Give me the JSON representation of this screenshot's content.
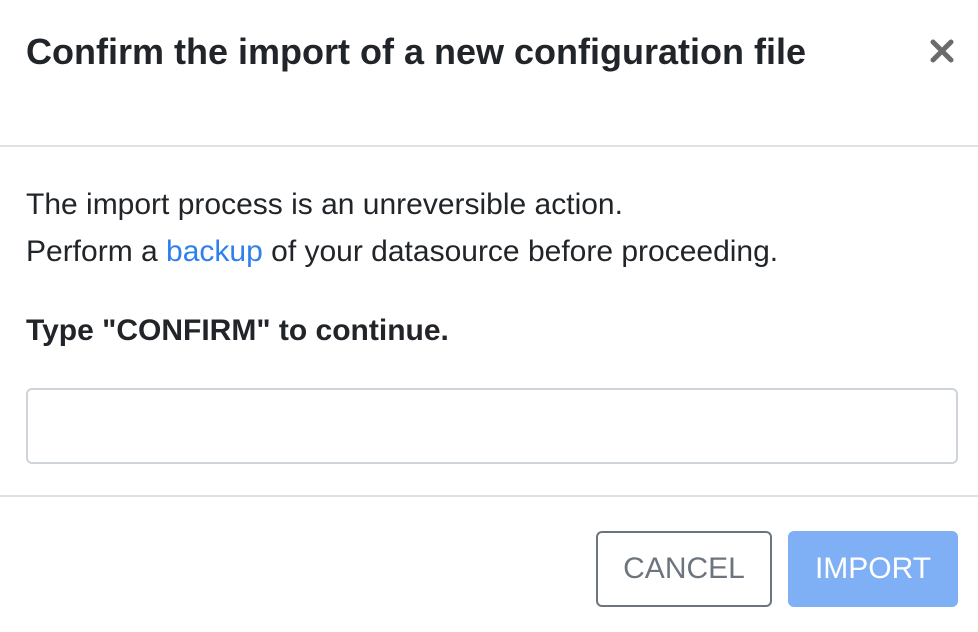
{
  "modal": {
    "title": "Confirm the import of a new configuration file",
    "close_icon": "close-icon",
    "body": {
      "line1": "The import process is an unreversible action.",
      "line2_prefix": "Perform a ",
      "line2_link": "backup",
      "line2_suffix": " of your datasource before proceeding.",
      "confirm_label": "Type \"CONFIRM\" to continue.",
      "input_value": "",
      "input_placeholder": ""
    },
    "footer": {
      "cancel_label": "CANCEL",
      "import_label": "IMPORT",
      "import_disabled": true
    }
  },
  "colors": {
    "link": "#2f80ed",
    "primary_disabled": "#7fb0f5",
    "secondary": "#6c757d",
    "text": "#212529",
    "divider": "#dee2e6"
  }
}
